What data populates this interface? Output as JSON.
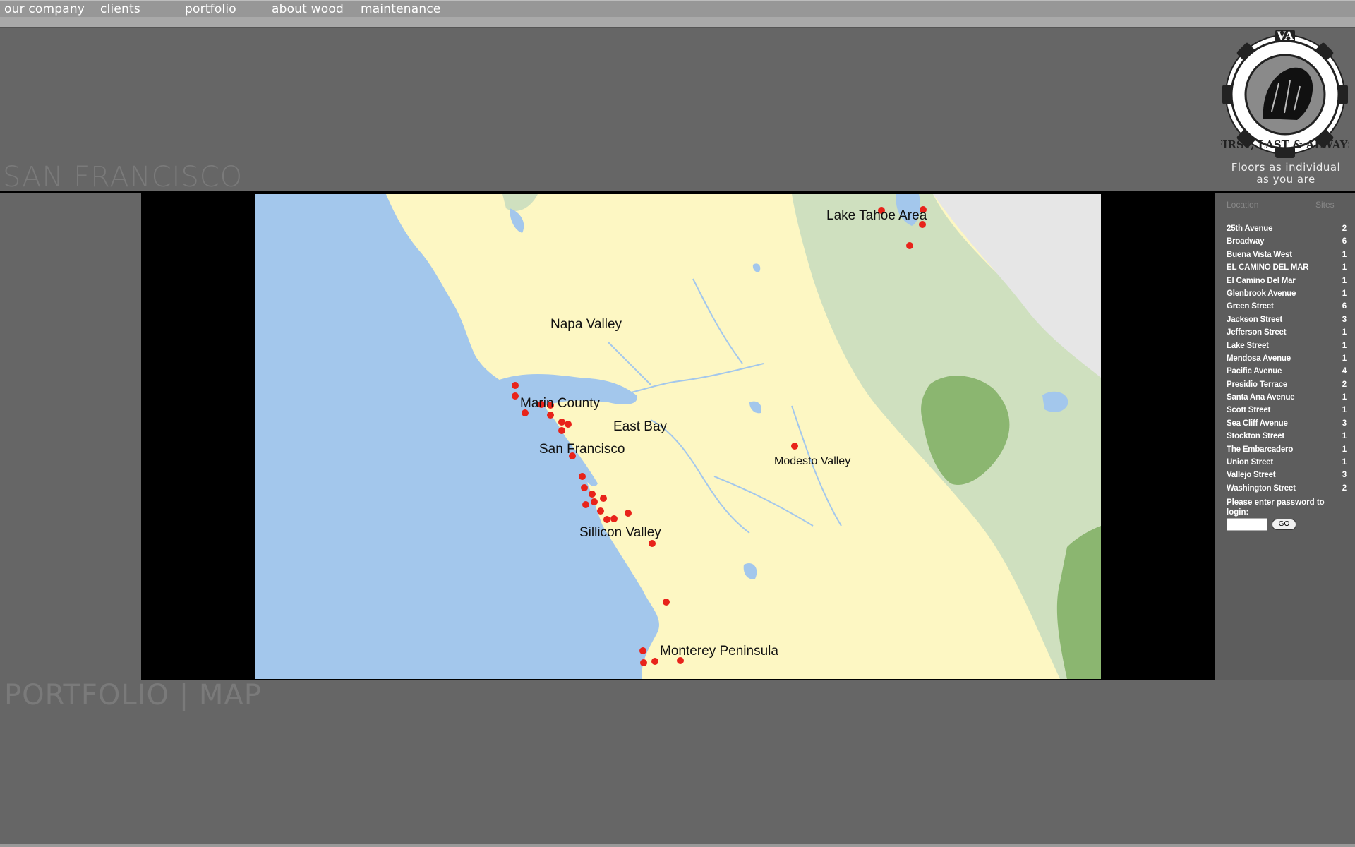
{
  "nav": {
    "items": [
      "our company",
      "clients",
      "portfolio",
      "about wood",
      "maintenance"
    ]
  },
  "header": {
    "section_title": "SAN FRANCISCO",
    "logo_text": "FIRST, LAST & ALWAYS",
    "tagline_line1": "Floors as individual",
    "tagline_line2": "as you are"
  },
  "map": {
    "labels": {
      "lake_tahoe": "Lake Tahoe Area",
      "napa": "Napa Valley",
      "marin": "Marin County",
      "east_bay": "East Bay",
      "san_francisco": "San Francisco",
      "modesto": "Modesto Valley",
      "silicon_valley": "Sillicon Valley",
      "monterey": "Monterey Peninsula"
    },
    "marker_color": "#e8231a"
  },
  "sidebar": {
    "header_location": "Location",
    "header_sites": "Sites",
    "locations": [
      {
        "name": "25th Avenue",
        "sites": "2"
      },
      {
        "name": "Broadway",
        "sites": "6"
      },
      {
        "name": "Buena Vista West",
        "sites": "1"
      },
      {
        "name": "EL CAMINO DEL MAR",
        "sites": "1"
      },
      {
        "name": "El Camino Del Mar",
        "sites": "1"
      },
      {
        "name": "Glenbrook Avenue",
        "sites": "1"
      },
      {
        "name": "Green Street",
        "sites": "6"
      },
      {
        "name": "Jackson Street",
        "sites": "3"
      },
      {
        "name": "Jefferson Street",
        "sites": "1"
      },
      {
        "name": "Lake Street",
        "sites": "1"
      },
      {
        "name": "Mendosa Avenue",
        "sites": "1"
      },
      {
        "name": "Pacific Avenue",
        "sites": "4"
      },
      {
        "name": "Presidio Terrace",
        "sites": "2"
      },
      {
        "name": "Santa Ana Avenue",
        "sites": "1"
      },
      {
        "name": "Scott Street",
        "sites": "1"
      },
      {
        "name": "Sea Cliff Avenue",
        "sites": "3"
      },
      {
        "name": "Stockton Street",
        "sites": "1"
      },
      {
        "name": "The Embarcadero",
        "sites": "1"
      },
      {
        "name": "Union Street",
        "sites": "1"
      },
      {
        "name": "Vallejo Street",
        "sites": "3"
      },
      {
        "name": "Washington Street",
        "sites": "2"
      }
    ],
    "password_label": "Please enter password to login:",
    "password_value": "",
    "go_label": "GO"
  },
  "footer": {
    "title": "PORTFOLIO | MAP"
  },
  "colors": {
    "background": "#666666",
    "land": "#fdf7c3",
    "water": "#a3c7ec",
    "forest": "#cfe0bf",
    "park": "#8bb670"
  }
}
